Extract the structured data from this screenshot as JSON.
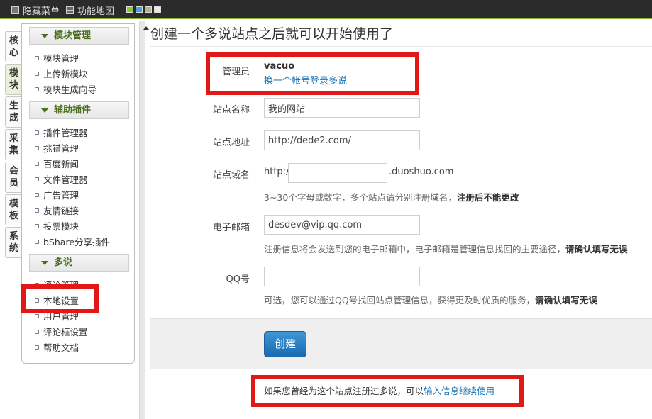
{
  "topbar": {
    "hide_menu_label": "隐藏菜单",
    "function_map_label": "功能地图",
    "hide_menu_icon": "hide-menu-icon",
    "function_map_icon": "grid-icon",
    "theme_swatches": [
      "#8fc43a",
      "#4aa0d8",
      "#bfae8a",
      "#e9e9e9"
    ],
    "accent_color": "#8fb43a"
  },
  "vertical_tabs": [
    {
      "label": "核心"
    },
    {
      "label": "模块",
      "active": true
    },
    {
      "label": "生成"
    },
    {
      "label": "采集"
    },
    {
      "label": "会员"
    },
    {
      "label": "模板"
    },
    {
      "label": "系统"
    }
  ],
  "sidebar": {
    "sections": [
      {
        "title": "模块管理",
        "items": [
          "模块管理",
          "上传新模块",
          "模块生成向导"
        ]
      },
      {
        "title": "辅助插件",
        "items": [
          "插件管理器",
          "挑错管理",
          "百度新闻",
          "文件管理器",
          "广告管理",
          "友情链接",
          "投票模块",
          "bShare分享插件"
        ]
      },
      {
        "title": "多说",
        "items": [
          "评论管理",
          "本地设置",
          "用户管理",
          "评论框设置",
          "帮助文档"
        ]
      }
    ]
  },
  "main": {
    "title": "创建一个多说站点之后就可以开始使用了",
    "admin": {
      "label": "管理员",
      "username": "vacuo",
      "switch_link": "换一个帐号登录多说"
    },
    "site_name": {
      "label": "站点名称",
      "value": "我的网站"
    },
    "site_url": {
      "label": "站点地址",
      "value": "http://dede2.com/"
    },
    "site_domain": {
      "label": "站点域名",
      "prefix": "http://",
      "value": "",
      "suffix": ".duoshuo.com",
      "help": "3~30个字母或数字，多个站点请分别注册域名，",
      "help_bold": "注册后不能更改"
    },
    "email": {
      "label": "电子邮箱",
      "value": "desdev@vip.qq.com",
      "help": "注册信息将会发送到您的电子邮箱中，电子邮箱是管理信息找回的主要途径，",
      "help_bold": "请确认填写无误"
    },
    "qq": {
      "label": "QQ号",
      "value": "",
      "help": "可选，您可以通过QQ号找回站点管理信息，获得更及时优质的服务，",
      "help_bold": "请确认填写无误"
    },
    "create_button": "创建",
    "footer_text": "如果您曾经为这个站点注册过多说，可以",
    "footer_link": "输入信息继续使用"
  },
  "highlight_color": "#e21818"
}
